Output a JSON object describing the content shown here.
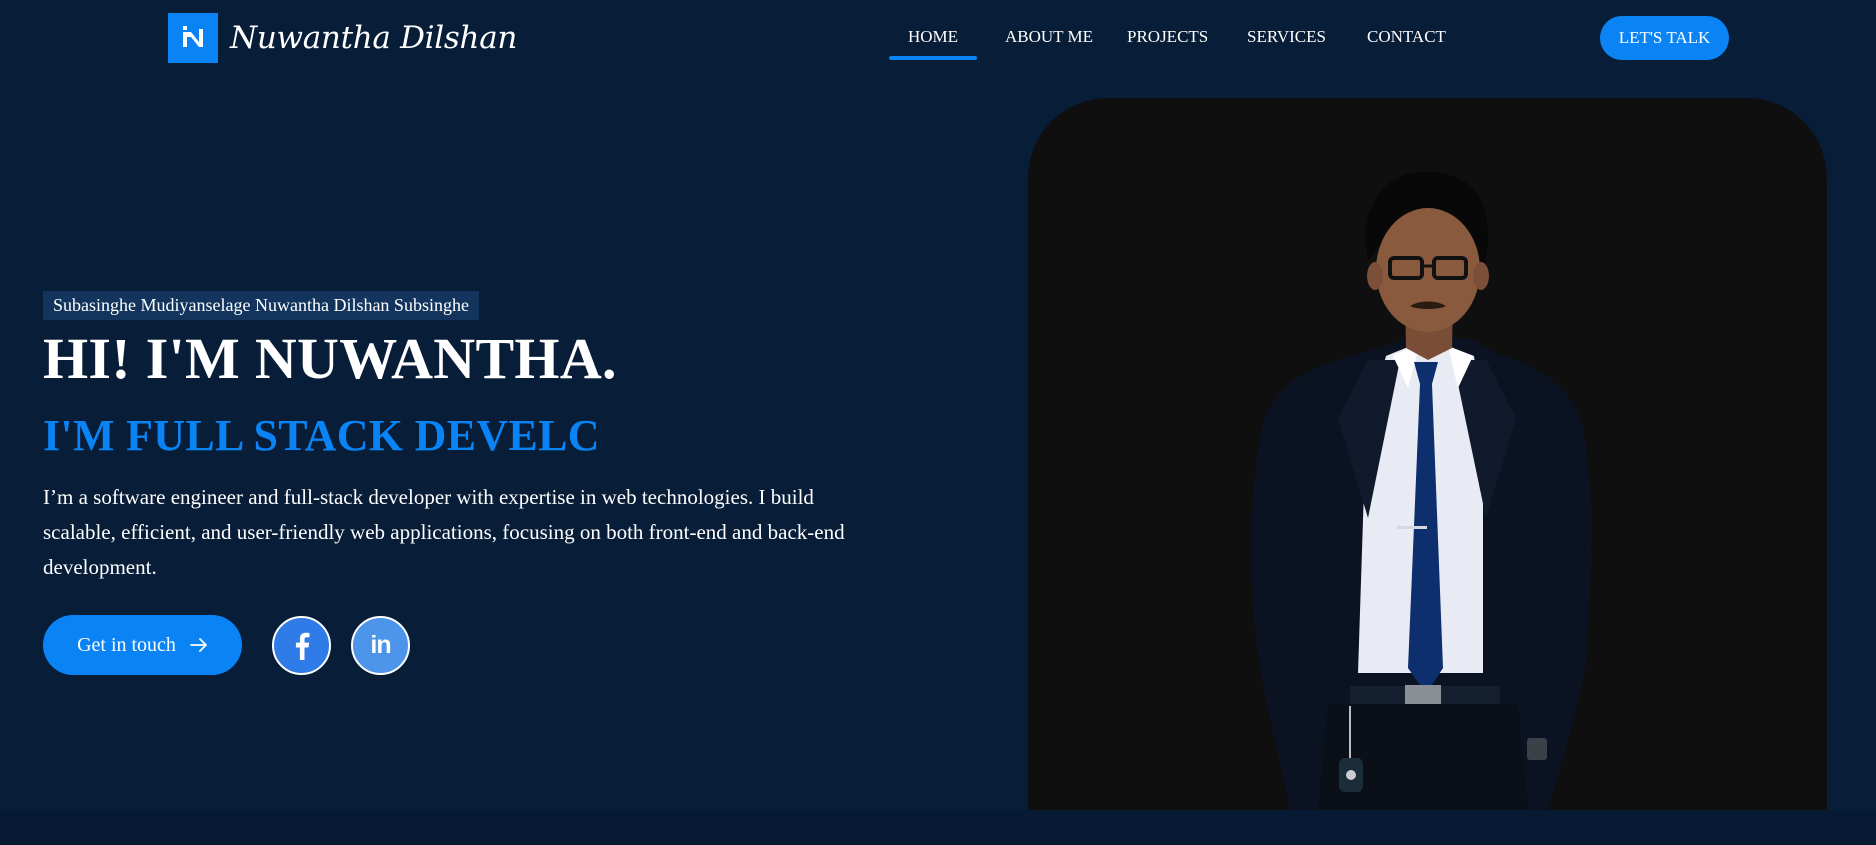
{
  "brand": {
    "name": "Nuwantha Dilshan",
    "logo_icon": "n-logo-icon",
    "accent_color": "#0a84f5",
    "background_color": "#071d38"
  },
  "nav": {
    "items": [
      {
        "label": "HOME",
        "active": true
      },
      {
        "label": "ABOUT ME",
        "active": false
      },
      {
        "label": "PROJECTS",
        "active": false
      },
      {
        "label": "SERVICES",
        "active": false
      },
      {
        "label": "CONTACT",
        "active": false
      }
    ],
    "cta_label": "LET'S TALK"
  },
  "hero": {
    "full_name": "Subasinghe Mudiyanselage Nuwantha Dilshan Subsinghe",
    "title": "HI! I'M NUWANTHA.",
    "role_typed": "I'M FULL STACK DEVELC",
    "description": "I’m a software engineer and full-stack developer with expertise in web technologies. I build scalable, efficient, and user-friendly web applications, focusing on both front-end and back-end development.",
    "button_label": "Get in touch",
    "button_icon": "arrow-right-icon",
    "socials": [
      {
        "icon": "facebook-icon"
      },
      {
        "icon": "linkedin-icon",
        "text": "in"
      }
    ],
    "portrait": "profile-photo"
  }
}
